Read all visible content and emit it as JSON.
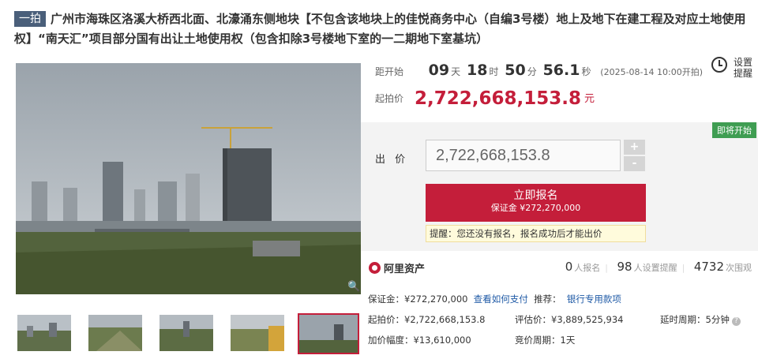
{
  "title": {
    "badge": "一拍",
    "text": "广州市海珠区洛溪大桥西北面、北濠涌东侧地块【不包含该地块上的佳悦商务中心（自编3号楼）地上及地下在建工程及对应土地使用权】“南天汇”项目部分国有出让土地使用权（包含扣除3号楼地下室的一二期地下室基坑）"
  },
  "countdown": {
    "label": "距开始",
    "days": "09",
    "days_unit": "天",
    "hours": "18",
    "hours_unit": "时",
    "minutes": "50",
    "minutes_unit": "分",
    "seconds": "56.1",
    "seconds_unit": "秒",
    "note": "(2025-08-14 10:00开拍)"
  },
  "alarm": {
    "line1": "设置",
    "line2": "提醒",
    "icon": "alarm-clock-icon"
  },
  "start_price": {
    "label": "起拍价",
    "value": "2,722,668,153.8",
    "unit": "元"
  },
  "bid": {
    "soon_badge": "即将开始",
    "label": "出 价",
    "input_value": "2,722,668,153.8",
    "plus": "+",
    "minus": "-",
    "signup_label": "立即报名",
    "deposit_label": "保证金 ¥272,270,000",
    "tip": "提醒：您还没有报名，报名成功后才能出价"
  },
  "stats": {
    "logo": "阿里资产",
    "signups": "0",
    "signups_label": "人报名",
    "reminders": "98",
    "reminders_label": "人设置提醒",
    "views": "4732",
    "views_label": "次围观"
  },
  "info": {
    "deposit": "保证金：¥272,270,000",
    "how_to_pay": "查看如何支付",
    "recommend_label": "推荐：",
    "bank_loan": "银行专用款项",
    "start_price": "起拍价：¥2,722,668,153.8",
    "appraisal": "评估价：¥3,889,525,934",
    "delay": "延时周期：5分钟",
    "increment": "加价幅度：¥13,610,000",
    "bid_cycle": "竞价周期：1天"
  },
  "colors": {
    "accent": "#c41e3a",
    "link": "#1f5aa6",
    "badge_green": "#3f9d52",
    "title_badge": "#4a5f7a"
  }
}
